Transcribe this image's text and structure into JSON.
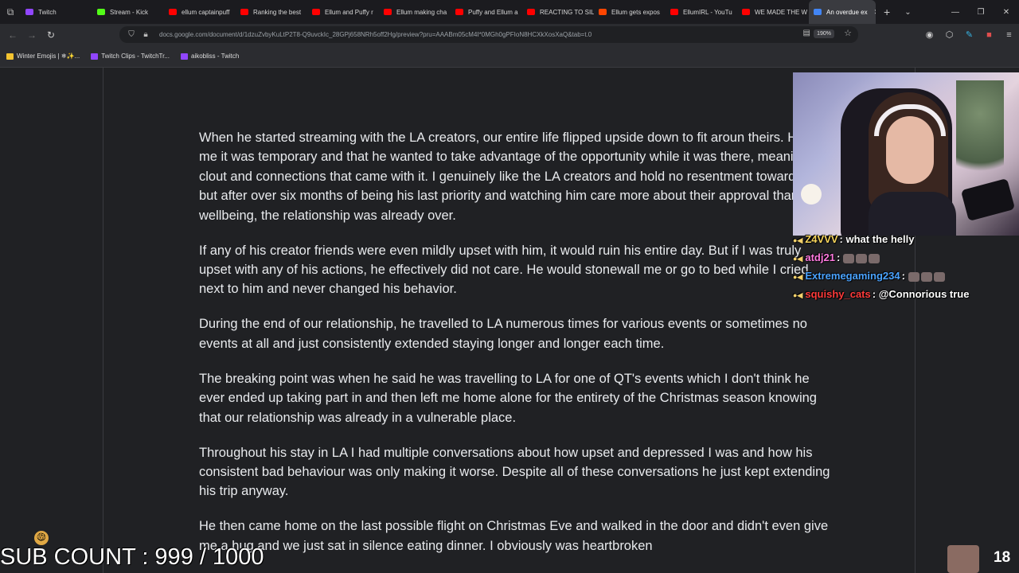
{
  "browser": {
    "tabs": [
      {
        "label": "Twitch",
        "color": "#9146ff"
      },
      {
        "label": "Stream - Kick",
        "color": "#53fc18"
      },
      {
        "label": "ellum captainpuff",
        "color": "#ff0000"
      },
      {
        "label": "Ranking the best",
        "color": "#ff0000"
      },
      {
        "label": "Ellum and Puffy r",
        "color": "#ff0000"
      },
      {
        "label": "Ellum making cha",
        "color": "#ff0000"
      },
      {
        "label": "Puffy and Ellum a",
        "color": "#ff0000"
      },
      {
        "label": "REACTING TO SIL",
        "color": "#ff0000"
      },
      {
        "label": "Ellum gets expos",
        "color": "#ff4500"
      },
      {
        "label": "EllumIRL - YouTu",
        "color": "#ff0000"
      },
      {
        "label": "WE MADE THE W",
        "color": "#ff0000"
      },
      {
        "label": "An overdue ex",
        "color": "#4285f4",
        "active": true
      }
    ],
    "new_tab": "+",
    "url": "docs.google.com/document/d/1dzuZvbyKuLtP2T8-Q9uvckIc_28GPj658NRh5off2Hg/preview?pru=AAABm05cM4I*0MGh0gPFIoN8HCXkXosXaQ&tab=t.0",
    "zoom": "190%",
    "bookmarks": [
      {
        "label": "Winter Emojis | ❄✨...",
        "color": "#f4c430"
      },
      {
        "label": "Twitch Clips - TwitchTr...",
        "color": "#9146ff"
      },
      {
        "label": "aikobliss - Twitch",
        "color": "#9146ff"
      }
    ]
  },
  "document": {
    "paragraphs": [
      "When he started streaming with the LA creators, our entire life flipped upside down to fit aroun theirs. He told me it was temporary and that he wanted to take advantage of the opportunity while it was there, meaning the clout and connections that came with it. I genuinely like the LA creators and hold no resentment toward them, but after over six months of being his last priority and watching him care more about their approval than my wellbeing, the relationship was already over.",
      "If any of his creator friends were even mildly upset with him, it would ruin his entire day. But if I was truly upset with any of his actions, he effectively did not care. He would stonewall me or go to bed while I cried next to him and never changed his behavior.",
      "During the end of our relationship, he travelled to LA numerous times for various events or sometimes no events at all and just consistently extended staying longer and longer each time.",
      " The breaking point was when he said he was travelling to LA for one of QT's events which I don't think he ever ended up taking part in and then left me home alone for the entirety of the Christmas season knowing that our relationship was already in a vulnerable place.",
      "Throughout his stay in LA I had multiple conversations about how upset and depressed I was and how his consistent bad behaviour was only making it worse. Despite all of these conversations he just kept extending his trip anyway.",
      "He then came home on the last possible flight on Christmas Eve and walked in the door and didn't even give me a hug and we just sat in silence eating dinner. I obviously was heartbroken"
    ]
  },
  "chat": [
    {
      "user": "Z4VVV",
      "user_color": "#f6d55c",
      "message": "what the helly"
    },
    {
      "user": "atdj21",
      "user_color": "#ff7ae0",
      "message": ""
    },
    {
      "user": "Extremegaming234",
      "user_color": "#4aa3ff",
      "message": ""
    },
    {
      "user": "squishy_cats",
      "user_color": "#ff3b3b",
      "message": "@Connorious true"
    }
  ],
  "overlay": {
    "sub_count": "SUB COUNT : 999 / 1000",
    "viewer_count": "18"
  }
}
